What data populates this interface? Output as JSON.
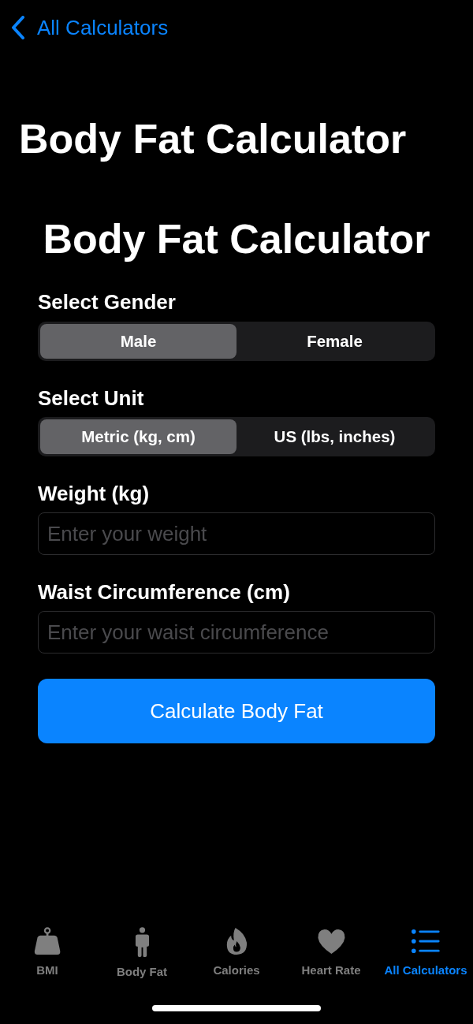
{
  "nav": {
    "back_label": "All Calculators"
  },
  "large_title": "Body Fat Calculator",
  "heading": "Body Fat Calculator",
  "segments": [
    {
      "label": "Select Gender",
      "options": [
        {
          "label": "Male",
          "selected": true
        },
        {
          "label": "Female",
          "selected": false
        }
      ]
    },
    {
      "label": "Select Unit",
      "options": [
        {
          "label": "Metric (kg, cm)",
          "selected": true
        },
        {
          "label": "US (lbs, inches)",
          "selected": false
        }
      ]
    }
  ],
  "fields": [
    {
      "label": "Weight (kg)",
      "placeholder": "Enter your weight"
    },
    {
      "label": "Waist Circumference (cm)",
      "placeholder": "Enter your waist circumference"
    }
  ],
  "calculate_button": "Calculate Body Fat",
  "tab_bar": [
    {
      "label": "BMI",
      "selected": false
    },
    {
      "label": "Body Fat",
      "selected": false
    },
    {
      "label": "Calories",
      "selected": false
    },
    {
      "label": "Heart Rate",
      "selected": false
    },
    {
      "label": "All Calculators",
      "selected": true
    }
  ]
}
